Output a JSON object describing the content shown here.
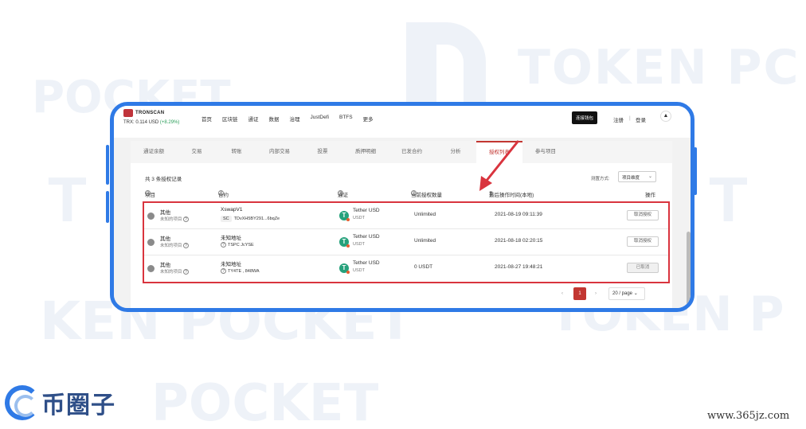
{
  "nav": {
    "logo": "TRONSCAN",
    "price_prefix": "TRX: 0.114 USD",
    "price_change": "(+8.29%)",
    "menu": [
      "首页",
      "区块链",
      "通证",
      "数据",
      "治理",
      "JustDefi",
      "BTFS",
      "更多"
    ],
    "connect": "连接钱包",
    "register": "注册",
    "separator": "|",
    "login": "登录"
  },
  "tabs": [
    "通证余额",
    "交易",
    "转账",
    "内部交易",
    "投票",
    "质押明细",
    "已发合约",
    "分析",
    "授权列表",
    "参与项目"
  ],
  "active_tab": "授权列表",
  "summary": "共 3 条授权记录",
  "filter": {
    "label": "测置方式:",
    "value": "项目维度"
  },
  "table": {
    "headers": [
      "项目",
      "合约",
      "通证",
      "当前授权数量",
      "最后操作时间(本地)",
      "操作"
    ],
    "rows": [
      {
        "project": "其他",
        "project_sub": "未知的项目",
        "contract": "XswapV1",
        "addr_tag": "SC",
        "addr": "TDvXH5BY291...6bqZe",
        "token": "Tether USD",
        "symbol": "USDT",
        "amount": "Unlimited",
        "time": "2021-08-19 09:11:39",
        "action": "取消授权",
        "disabled": false
      },
      {
        "project": "其他",
        "project_sub": "未知的项目",
        "contract": "未知地址",
        "addr_tag": "",
        "addr": "TSPC                    JcYSE",
        "token": "Tether USD",
        "symbol": "USDT",
        "amount": "Unlimited",
        "time": "2021-08-18 02:20:15",
        "action": "取消授权",
        "disabled": false
      },
      {
        "project": "其他",
        "project_sub": "未知的项目",
        "contract": "未知地址",
        "addr_tag": "",
        "addr": "TY4TE              ,           848WA",
        "token": "Tether USD",
        "symbol": "USDT",
        "amount": "0 USDT",
        "time": "2021-08-27 19:48:21",
        "action": "已取消",
        "disabled": true
      }
    ]
  },
  "pagination": {
    "prev": "‹",
    "current": "1",
    "next": "›",
    "page_size": "20 / page"
  },
  "watermark": [
    "TOKEN PC",
    "POCKET",
    "KEN POCKET",
    "TOKEN P",
    "POCKET"
  ],
  "brand": {
    "name": "币圈子",
    "site": "www.365jz.com"
  },
  "colors": {
    "accent": "#c23631",
    "frame": "#2f7ae6",
    "highlight": "#d9343e",
    "tether": "#26a17b"
  }
}
